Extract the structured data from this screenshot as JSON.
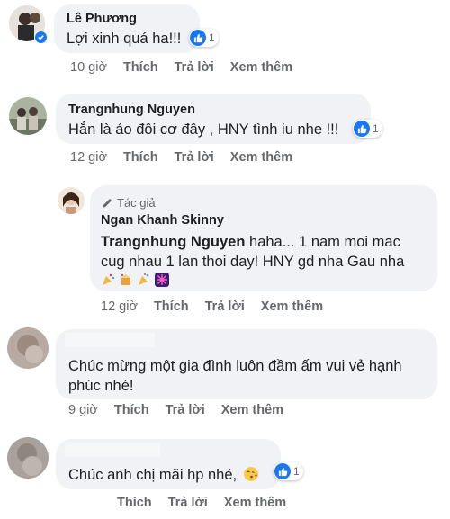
{
  "comments": [
    {
      "name": "Lê Phương",
      "text": "Lợi xinh quá ha!!!",
      "reaction_count": "1",
      "time": "10 giờ",
      "like_label": "Thích",
      "reply_label": "Trả lời",
      "more_label": "Xem thêm"
    },
    {
      "name": "Trangnhung Nguyen",
      "text": "Hẳn là áo đôi cơ đây , HNY tình iu nhe !!!",
      "reaction_count": "1",
      "time": "12 giờ",
      "like_label": "Thích",
      "reply_label": "Trả lời",
      "more_label": "Xem thêm"
    },
    {
      "author_badge": "Tác giả",
      "name": "Ngan Khanh Skinny",
      "mention": "Trangnhung Nguyen",
      "text_line1": "haha... 1 nam moi mac",
      "text_line2": "cug nhau 1 lan thoi day! HNY gd nha Gau nha",
      "time": "12 giờ",
      "like_label": "Thích",
      "reply_label": "Trả lời",
      "more_label": "Xem thêm"
    },
    {
      "name": "",
      "text_line1": "Chúc mừng một gia đình luôn đầm ấm vui vẻ hạnh",
      "text_line2": "phúc nhé!",
      "time": "9 giờ",
      "like_label": "Thích",
      "reply_label": "Trả lời",
      "more_label": "Xem thêm"
    },
    {
      "name": "",
      "text": "Chúc anh chị mãi hp nhé,",
      "reaction_count": "1",
      "time": "",
      "like_label": "Thích",
      "reply_label": "Trả lời",
      "more_label": "Xem thêm"
    }
  ],
  "colors": {
    "bubble": "#f0f2f5",
    "like_blue": "#1877f2",
    "meta_gray": "#65676b"
  },
  "icons": [
    "verified-badge-icon",
    "like-reaction-icon",
    "pencil-icon",
    "party-emoji",
    "fireworks-emoji",
    "kiss-emoji"
  ]
}
